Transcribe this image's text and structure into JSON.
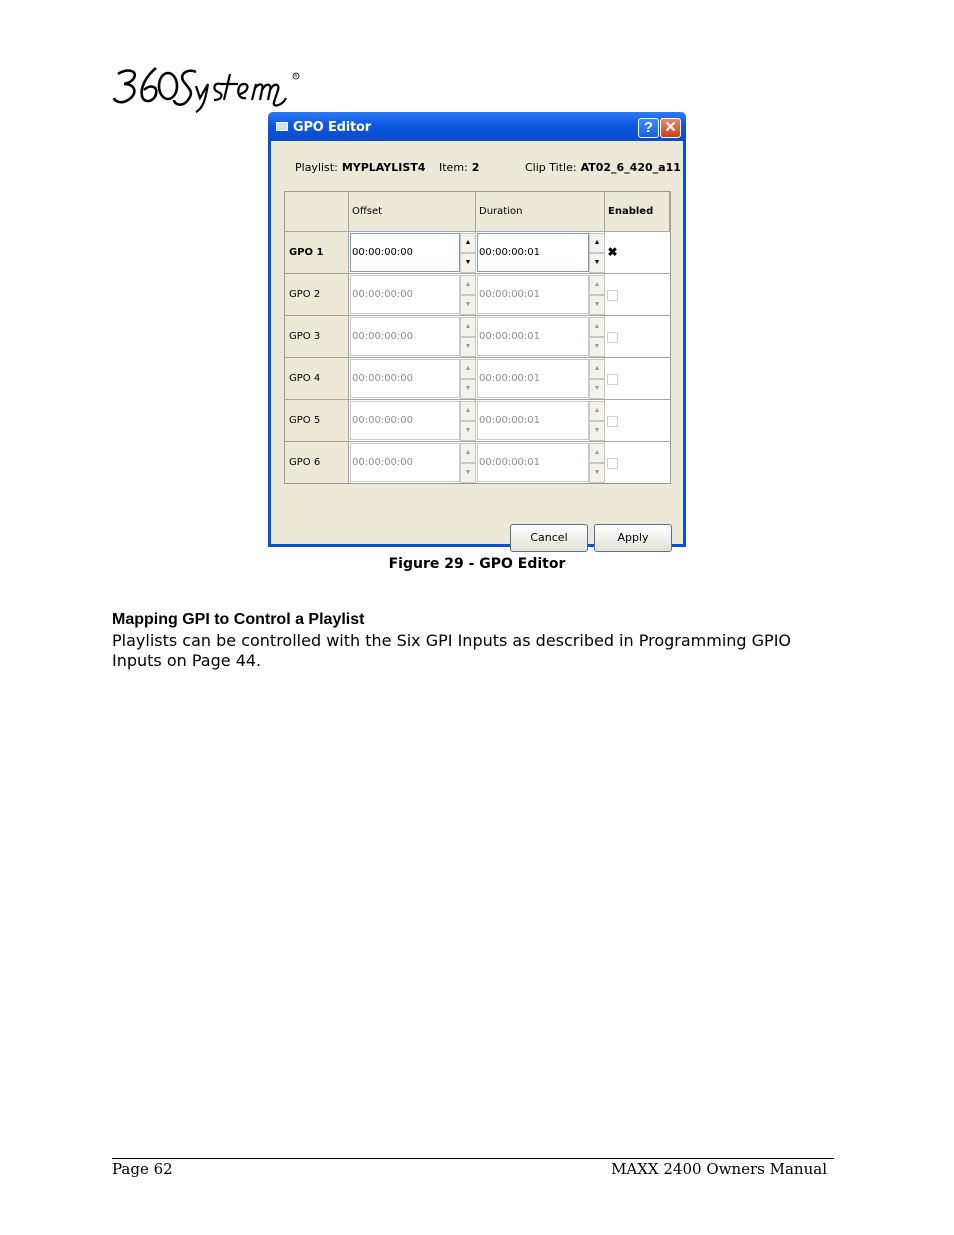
{
  "logo": {
    "text": "360 Systems"
  },
  "dialog": {
    "title": "GPO Editor",
    "help_button": "?",
    "close_button": "✕",
    "playlist_label": "Playlist:",
    "playlist_value": "MYPLAYLIST4",
    "item_label": "Item:",
    "item_value": "2",
    "clip_label": "Clip Title:",
    "clip_value": "AT02_6_420_a11",
    "columns": {
      "offset": "Offset",
      "duration": "Duration",
      "enabled": "Enabled"
    },
    "rows": [
      {
        "label": "GPO 1",
        "offset": "00:00:00:00",
        "duration": "00:00:00:01",
        "enabled": true
      },
      {
        "label": "GPO 2",
        "offset": "00:00:00:00",
        "duration": "00:00:00:01",
        "enabled": false
      },
      {
        "label": "GPO 3",
        "offset": "00:00:00:00",
        "duration": "00:00:00:01",
        "enabled": false
      },
      {
        "label": "GPO 4",
        "offset": "00:00:00:00",
        "duration": "00:00:00:01",
        "enabled": false
      },
      {
        "label": "GPO 5",
        "offset": "00:00:00:00",
        "duration": "00:00:00:01",
        "enabled": false
      },
      {
        "label": "GPO 6",
        "offset": "00:00:00:00",
        "duration": "00:00:00:01",
        "enabled": false
      }
    ],
    "cancel_label": "Cancel",
    "apply_label": "Apply"
  },
  "caption": "Figure 29 - GPO Editor",
  "section": {
    "heading": "Mapping GPI to Control a Playlist",
    "body": "Playlists can be controlled with the Six GPI Inputs as described in Programming GPIO Inputs on Page 44."
  },
  "footer": {
    "page": "Page 62",
    "manual": "MAXX 2400 Owners Manual"
  }
}
